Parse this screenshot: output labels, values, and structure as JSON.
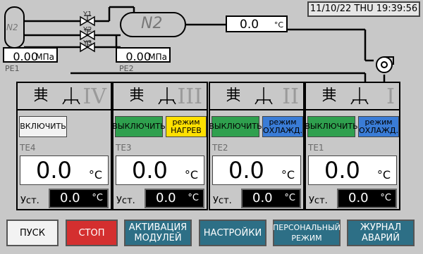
{
  "clock": "11/10/22 THU 19:39:56",
  "tanks": {
    "left_label": "N2",
    "right_label": "N2",
    "pe1": {
      "value": "0.00",
      "unit": "МПа",
      "label": "PE1"
    },
    "pe2": {
      "value": "0.00",
      "unit": "МПа",
      "label": "PE2"
    },
    "valves": [
      "Y1",
      "Y2",
      "Y3"
    ]
  },
  "main_temp": {
    "value": "0.0",
    "unit": "°C"
  },
  "zones": [
    {
      "roman": "IV",
      "te": "TE4",
      "temp": "0.0",
      "temp_unit": "°C",
      "set_label": "Уст.",
      "set_value": "0.0",
      "set_unit": "°C",
      "button": "ВКЛЮЧИТЬ"
    },
    {
      "roman": "III",
      "te": "TE3",
      "temp": "0.0",
      "temp_unit": "°C",
      "set_label": "Уст.",
      "set_value": "0.0",
      "set_unit": "°C",
      "button": "ВЫКЛЮЧИТЬ",
      "mode": "режим\nНАГРЕВ"
    },
    {
      "roman": "II",
      "te": "TE2",
      "temp": "0.0",
      "temp_unit": "°C",
      "set_label": "Уст.",
      "set_value": "0.0",
      "set_unit": "°C",
      "button": "ВЫКЛЮЧИТЬ",
      "mode": "режим\nОХЛАЖД."
    },
    {
      "roman": "I",
      "te": "TE1",
      "temp": "0.0",
      "temp_unit": "°C",
      "set_label": "Уст.",
      "set_value": "0.0",
      "set_unit": "°C",
      "button": "ВЫКЛЮЧИТЬ",
      "mode": "режим\nОХЛАЖД."
    }
  ],
  "bottom": {
    "start": "ПУСК",
    "stop": "СТОП",
    "activation": "АКТИВАЦИЯ\nМОДУЛЕЙ",
    "settings": "НАСТРОЙКИ",
    "personal": "ПЕРСОНАЛЬНЫЙ\nРЕЖИМ",
    "journal": "ЖУРНАЛ\nАВАРИЙ"
  },
  "colors": {
    "green": "#2fa04e",
    "yellow": "#ffe000",
    "blue": "#3a7cd6",
    "red": "#d42f2f",
    "teal": "#2d6f86"
  }
}
